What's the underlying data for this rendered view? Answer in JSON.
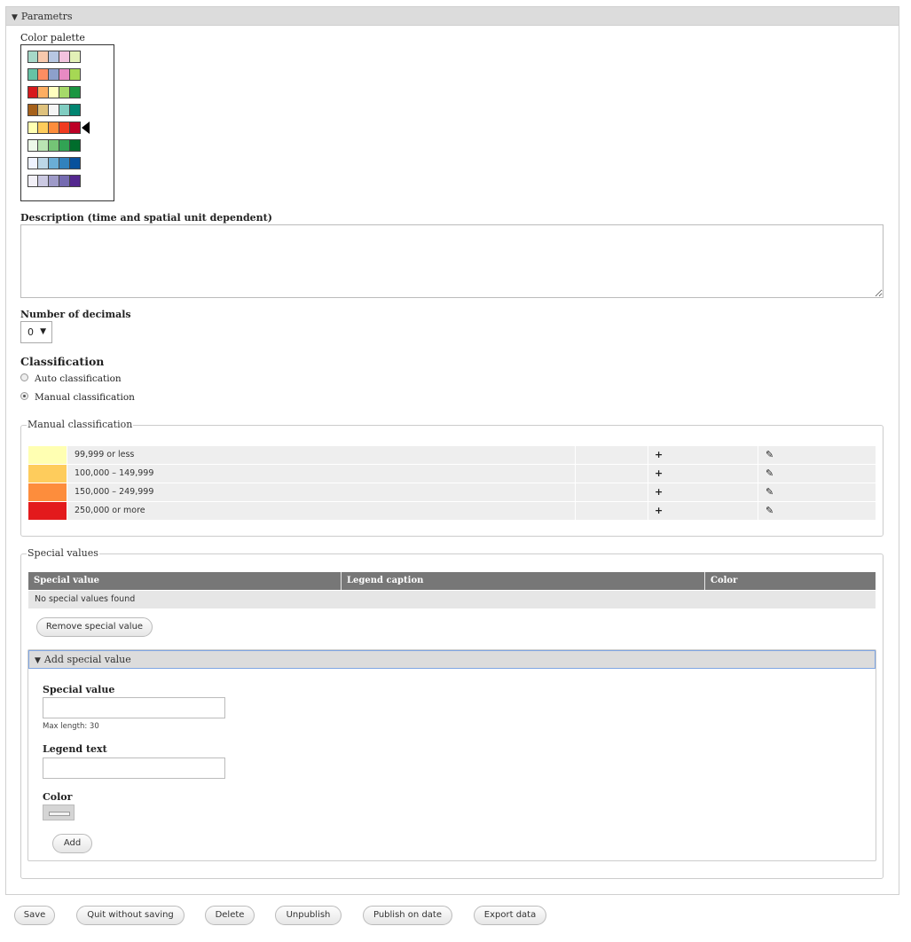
{
  "params": {
    "toggle_icon": "triangle-down-icon",
    "title": "Parametrs"
  },
  "palette": {
    "label": "Color palette",
    "rows": [
      [
        "#a6d8c8",
        "#f8c9ad",
        "#b7c7e2",
        "#f2c2de",
        "#e3f1b7"
      ],
      [
        "#66c2a5",
        "#fc8d62",
        "#8da0cb",
        "#e78ac3",
        "#a6d854"
      ],
      [
        "#d7191c",
        "#fdae61",
        "#ffffbf",
        "#a6d96a",
        "#1a9641"
      ],
      [
        "#a6611a",
        "#dfc27d",
        "#f5f5f5",
        "#80cdc1",
        "#018571"
      ],
      [
        "#ffffb2",
        "#fecc5c",
        "#fd8d3c",
        "#f03b20",
        "#bd0026"
      ],
      [
        "#edf8e9",
        "#bae4b3",
        "#74c476",
        "#31a354",
        "#006d2c"
      ],
      [
        "#eff3ff",
        "#bdd7e7",
        "#6baed6",
        "#3182bd",
        "#08519c"
      ],
      [
        "#f2f0f7",
        "#cbc9e2",
        "#9e9ac8",
        "#756bb1",
        "#54278f"
      ]
    ],
    "selected_index": 4,
    "selected_icon": "triangle-left-icon"
  },
  "description": {
    "label": "Description (time and spatial unit dependent)",
    "value": ""
  },
  "decimals": {
    "label": "Number of decimals",
    "value": "0"
  },
  "classification": {
    "title": "Classification",
    "options": [
      "Auto classification",
      "Manual classification"
    ],
    "selected": "Manual classification"
  },
  "manual": {
    "legend": "Manual classification",
    "rows": [
      {
        "color": "#ffffb2",
        "label": "99,999 or less"
      },
      {
        "color": "#fecc5c",
        "label": "100,000 – 149,999"
      },
      {
        "color": "#fd8d3c",
        "label": "150,000 – 249,999"
      },
      {
        "color": "#e31a1c",
        "label": "250,000 or more"
      }
    ],
    "add_icon": "plus-icon",
    "edit_icon": "pencil-icon"
  },
  "special": {
    "legend": "Special values",
    "columns": [
      "Special value",
      "Legend caption",
      "Color"
    ],
    "empty_text": "No special values found",
    "remove_button": "Remove special value",
    "add_panel": {
      "title": "Add special value",
      "value_label": "Special value",
      "value": "",
      "max_length_text": "Max length: 30",
      "legend_label": "Legend text",
      "legend_value": "",
      "color_label": "Color",
      "add_button": "Add"
    }
  },
  "footer": [
    "Save",
    "Quit without saving",
    "Delete",
    "Unpublish",
    "Publish on date",
    "Export data"
  ]
}
